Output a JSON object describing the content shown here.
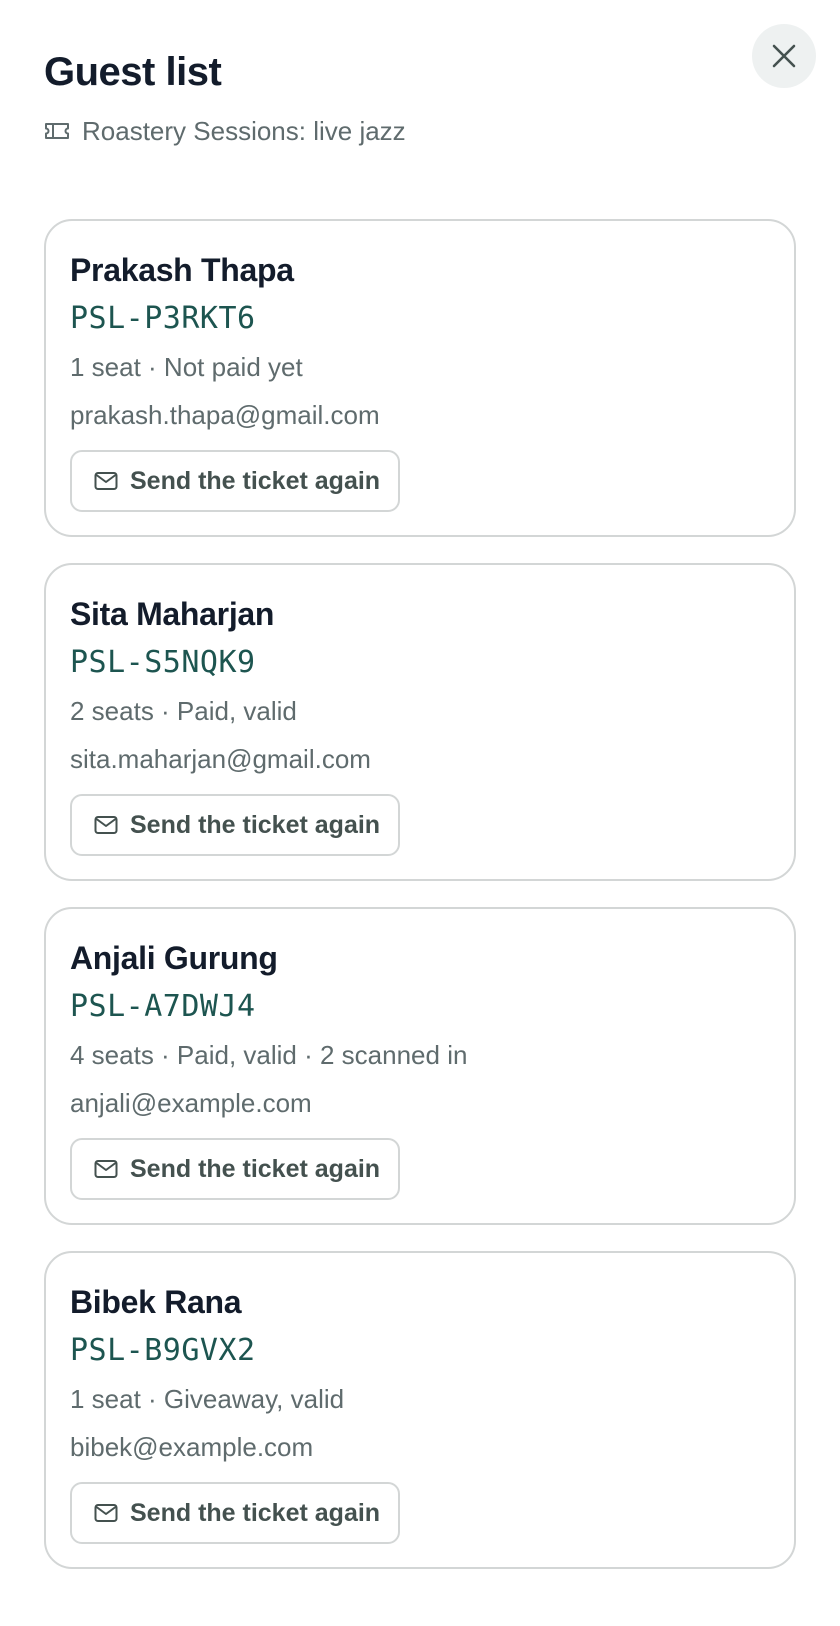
{
  "header": {
    "title": "Guest list",
    "event_icon": "ticket-icon",
    "event_name": "Roastery Sessions: live jazz",
    "close_icon": "close-icon"
  },
  "guests": [
    {
      "name": "Prakash Thapa",
      "code": "PSL-P3RKT6",
      "meta": "1 seat · Not paid yet",
      "email": "prakash.thapa@gmail.com",
      "action_icon": "mail-icon",
      "action_label": "Send the ticket again"
    },
    {
      "name": "Sita Maharjan",
      "code": "PSL-S5NQK9",
      "meta": "2 seats · Paid, valid",
      "email": "sita.maharjan@gmail.com",
      "action_icon": "mail-icon",
      "action_label": "Send the ticket again"
    },
    {
      "name": "Anjali Gurung",
      "code": "PSL-A7DWJ4",
      "meta": "4 seats · Paid, valid · 2 scanned in",
      "email": "anjali@example.com",
      "action_icon": "mail-icon",
      "action_label": "Send the ticket again"
    },
    {
      "name": "Bibek Rana",
      "code": "PSL-B9GVX2",
      "meta": "1 seat · Giveaway, valid",
      "email": "bibek@example.com",
      "action_icon": "mail-icon",
      "action_label": "Send the ticket again"
    }
  ]
}
